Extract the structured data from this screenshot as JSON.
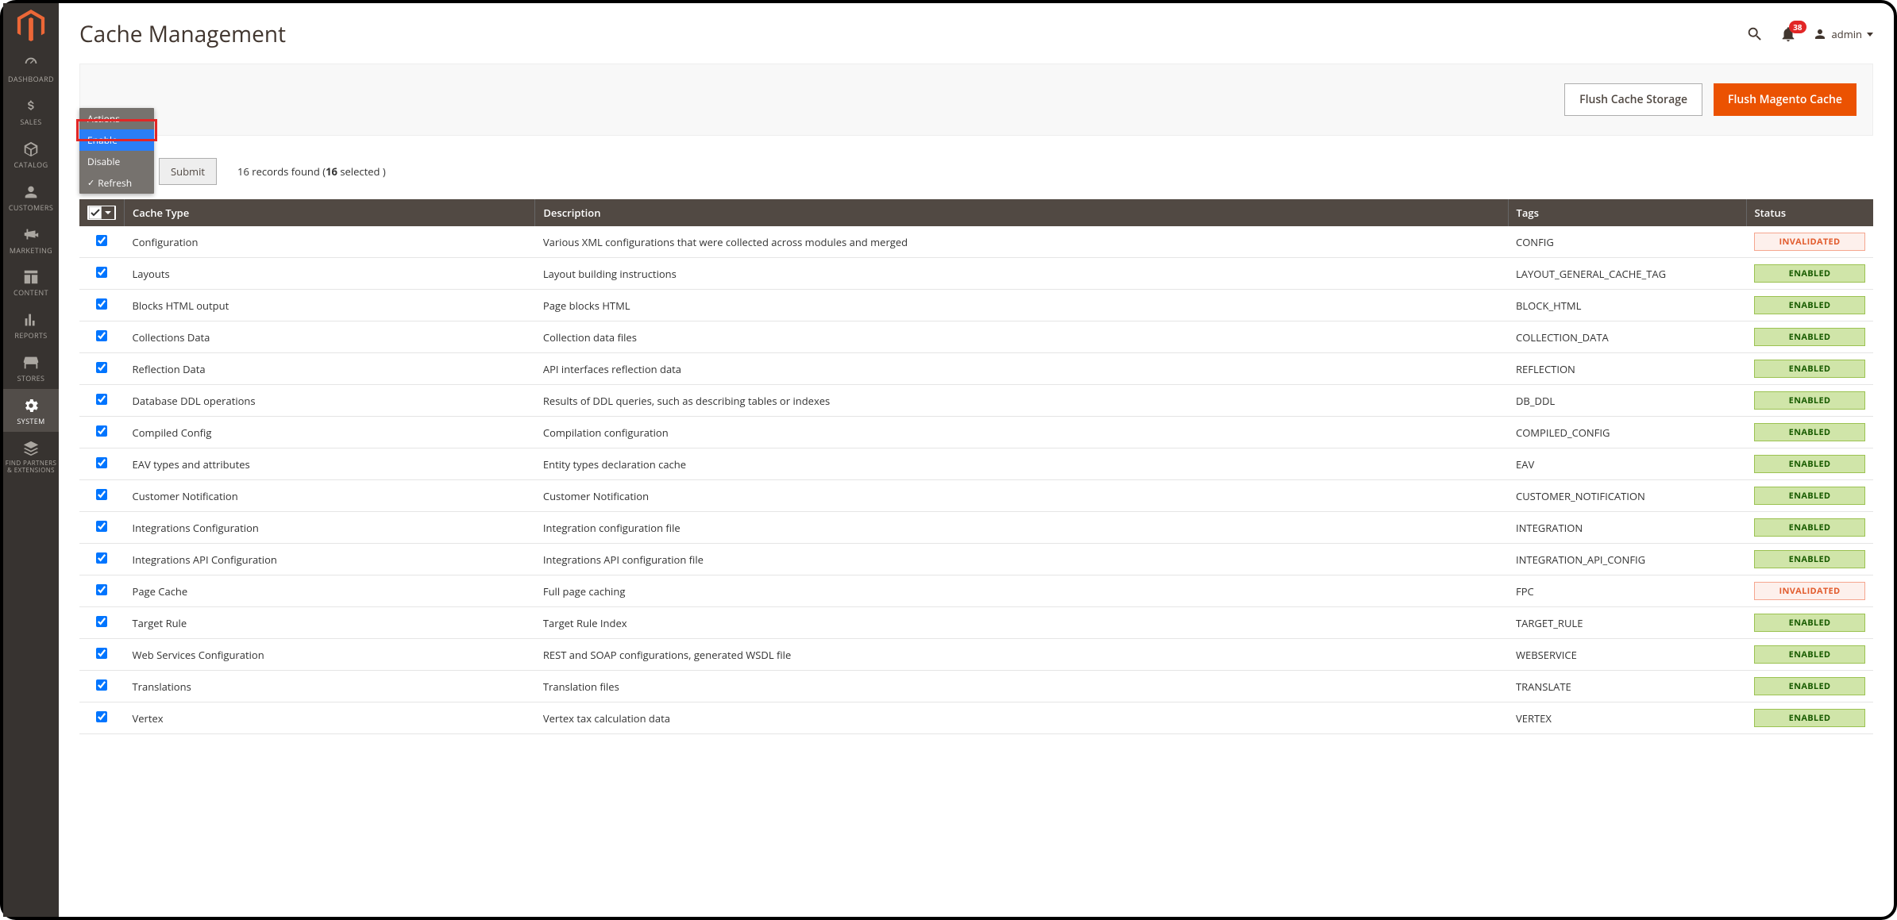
{
  "header": {
    "title": "Cache Management",
    "notifications_count": "38",
    "user_label": "admin"
  },
  "buttons": {
    "flush_storage": "Flush Cache Storage",
    "flush_magento": "Flush Magento Cache",
    "submit": "Submit"
  },
  "actions_menu": {
    "title": "Actions",
    "items": [
      "Enable",
      "Disable",
      "Refresh"
    ],
    "selected_index": 0,
    "checked_index": 2
  },
  "records_text_prefix": "16 records found (",
  "records_text_bold": "16",
  "records_text_suffix": " selected )",
  "columns": {
    "cache_type": "Cache Type",
    "description": "Description",
    "tags": "Tags",
    "status": "Status"
  },
  "status_labels": {
    "enabled": "ENABLED",
    "invalidated": "INVALIDATED"
  },
  "rows": [
    {
      "type": "Configuration",
      "desc": "Various XML configurations that were collected across modules and merged",
      "tags": "CONFIG",
      "status": "invalidated"
    },
    {
      "type": "Layouts",
      "desc": "Layout building instructions",
      "tags": "LAYOUT_GENERAL_CACHE_TAG",
      "status": "enabled"
    },
    {
      "type": "Blocks HTML output",
      "desc": "Page blocks HTML",
      "tags": "BLOCK_HTML",
      "status": "enabled"
    },
    {
      "type": "Collections Data",
      "desc": "Collection data files",
      "tags": "COLLECTION_DATA",
      "status": "enabled"
    },
    {
      "type": "Reflection Data",
      "desc": "API interfaces reflection data",
      "tags": "REFLECTION",
      "status": "enabled"
    },
    {
      "type": "Database DDL operations",
      "desc": "Results of DDL queries, such as describing tables or indexes",
      "tags": "DB_DDL",
      "status": "enabled"
    },
    {
      "type": "Compiled Config",
      "desc": "Compilation configuration",
      "tags": "COMPILED_CONFIG",
      "status": "enabled"
    },
    {
      "type": "EAV types and attributes",
      "desc": "Entity types declaration cache",
      "tags": "EAV",
      "status": "enabled"
    },
    {
      "type": "Customer Notification",
      "desc": "Customer Notification",
      "tags": "CUSTOMER_NOTIFICATION",
      "status": "enabled"
    },
    {
      "type": "Integrations Configuration",
      "desc": "Integration configuration file",
      "tags": "INTEGRATION",
      "status": "enabled"
    },
    {
      "type": "Integrations API Configuration",
      "desc": "Integrations API configuration file",
      "tags": "INTEGRATION_API_CONFIG",
      "status": "enabled"
    },
    {
      "type": "Page Cache",
      "desc": "Full page caching",
      "tags": "FPC",
      "status": "invalidated"
    },
    {
      "type": "Target Rule",
      "desc": "Target Rule Index",
      "tags": "TARGET_RULE",
      "status": "enabled"
    },
    {
      "type": "Web Services Configuration",
      "desc": "REST and SOAP configurations, generated WSDL file",
      "tags": "WEBSERVICE",
      "status": "enabled"
    },
    {
      "type": "Translations",
      "desc": "Translation files",
      "tags": "TRANSLATE",
      "status": "enabled"
    },
    {
      "type": "Vertex",
      "desc": "Vertex tax calculation data",
      "tags": "VERTEX",
      "status": "enabled"
    }
  ],
  "sidebar": [
    {
      "label": "DASHBOARD",
      "icon": "dashboard"
    },
    {
      "label": "SALES",
      "icon": "dollar"
    },
    {
      "label": "CATALOG",
      "icon": "box"
    },
    {
      "label": "CUSTOMERS",
      "icon": "person"
    },
    {
      "label": "MARKETING",
      "icon": "megaphone"
    },
    {
      "label": "CONTENT",
      "icon": "layout"
    },
    {
      "label": "REPORTS",
      "icon": "chart"
    },
    {
      "label": "STORES",
      "icon": "store"
    },
    {
      "label": "SYSTEM",
      "icon": "gear",
      "active": true
    },
    {
      "label": "FIND PARTNERS & EXTENSIONS",
      "icon": "stack",
      "small": true
    }
  ]
}
